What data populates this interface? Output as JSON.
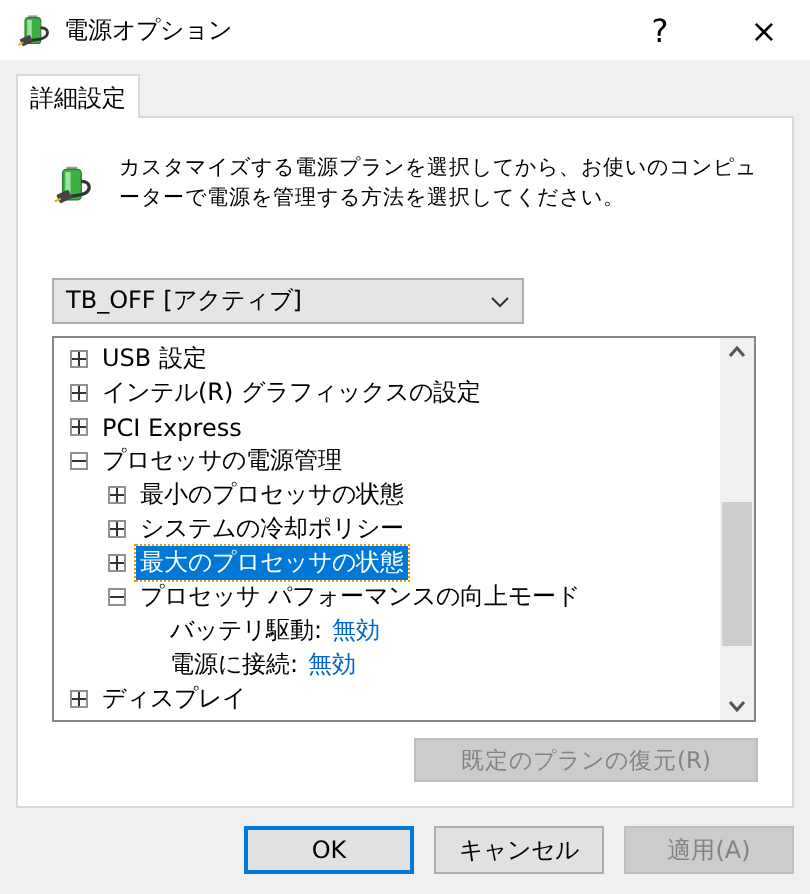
{
  "window": {
    "title": "電源オプション",
    "help": "?",
    "close": "×"
  },
  "tabs": [
    {
      "label": "詳細設定",
      "selected": true
    }
  ],
  "description": "カスタマイズする電源プランを選択してから、お使いのコンピューターで電源を管理する方法を選択してください。",
  "plan_select": {
    "value": "TB_OFF [アクティブ]"
  },
  "tree": [
    {
      "label": "USB 設定",
      "expanded": false,
      "selected": false
    },
    {
      "label": "インテル(R) グラフィックスの設定",
      "expanded": false,
      "selected": false
    },
    {
      "label": "PCI Express",
      "expanded": false,
      "selected": false
    },
    {
      "label": "プロセッサの電源管理",
      "expanded": true,
      "selected": false,
      "children": [
        {
          "label": "最小のプロセッサの状態",
          "expanded": false,
          "selected": false
        },
        {
          "label": "システムの冷却ポリシー",
          "expanded": false,
          "selected": false
        },
        {
          "label": "最大のプロセッサの状態",
          "expanded": false,
          "selected": true
        },
        {
          "label": "プロセッサ パフォーマンスの向上モード",
          "expanded": true,
          "selected": false,
          "settings": [
            {
              "label": "バッテリ駆動:",
              "value": "無効"
            },
            {
              "label": "電源に接続:",
              "value": "無効"
            }
          ]
        }
      ]
    },
    {
      "label": "ディスプレイ",
      "expanded": false,
      "selected": false
    }
  ],
  "restore_button": {
    "label": "既定のプランの復元(R)",
    "disabled": true
  },
  "buttons": [
    {
      "label": "OK",
      "disabled": false,
      "default": true
    },
    {
      "label": "キャンセル",
      "disabled": false,
      "default": false
    },
    {
      "label": "適用(A)",
      "disabled": true,
      "default": false
    }
  ]
}
